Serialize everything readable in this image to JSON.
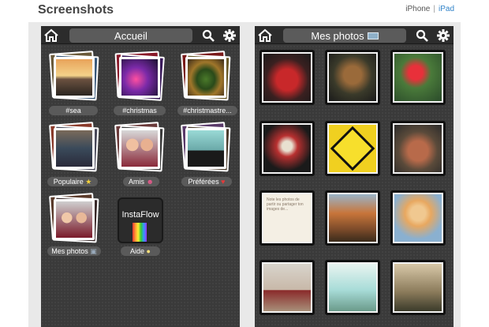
{
  "header": {
    "title": "Screenshots",
    "iphone": "iPhone",
    "separator": "|",
    "ipad": "iPad"
  },
  "left_screen": {
    "title": "Accueil",
    "tiles": [
      {
        "label": "#sea",
        "icon": "none"
      },
      {
        "label": "#christmas",
        "icon": "none"
      },
      {
        "label": "#christmastre...",
        "icon": "none"
      },
      {
        "label": "Populaire",
        "icon": "star"
      },
      {
        "label": "Amis",
        "icon": "people"
      },
      {
        "label": "Préférées",
        "icon": "heart"
      },
      {
        "label": "Mes photos",
        "icon": "camera"
      },
      {
        "label": "Aide",
        "icon": "lightbulb"
      }
    ],
    "logo_text": "InstaFlow"
  },
  "right_screen": {
    "title": "Mes photos",
    "note_text": "Note les photos de partir ou partager ton images de..."
  },
  "colors": {
    "link": "#2f82c8",
    "bar": "#2c2c2c",
    "pill": "#5b5b5b",
    "background": "#3a3a3a"
  }
}
